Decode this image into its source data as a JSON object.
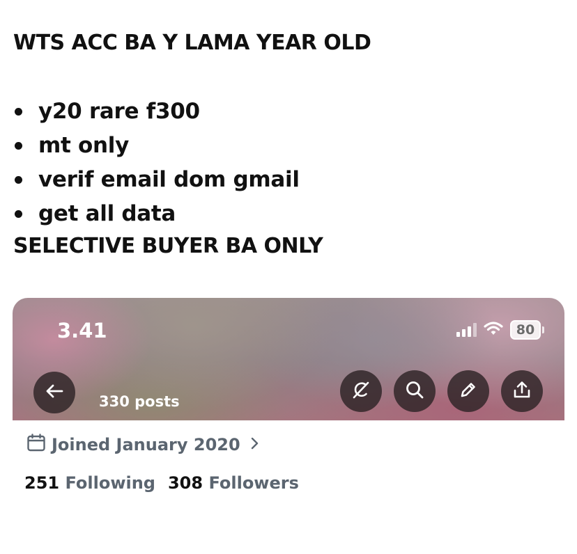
{
  "post": {
    "headline": "WTS ACC BA Y LAMA YEAR OLD",
    "bullets": [
      "y20 rare f300",
      "mt only",
      "verif email dom gmail",
      "get all data"
    ],
    "footer": "SELECTIVE BUYER BA ONLY"
  },
  "screenshot": {
    "status": {
      "time": "3.41",
      "battery": "80"
    },
    "posts_count": "330 posts",
    "joined": "Joined January 2020",
    "following_count": "251",
    "following_label": "Following",
    "followers_count": "308",
    "followers_label": "Followers",
    "icons": [
      "back-arrow-icon",
      "grok-icon",
      "search-icon",
      "edit-pencil-icon",
      "share-icon",
      "calendar-icon",
      "chevron-right-icon"
    ]
  }
}
